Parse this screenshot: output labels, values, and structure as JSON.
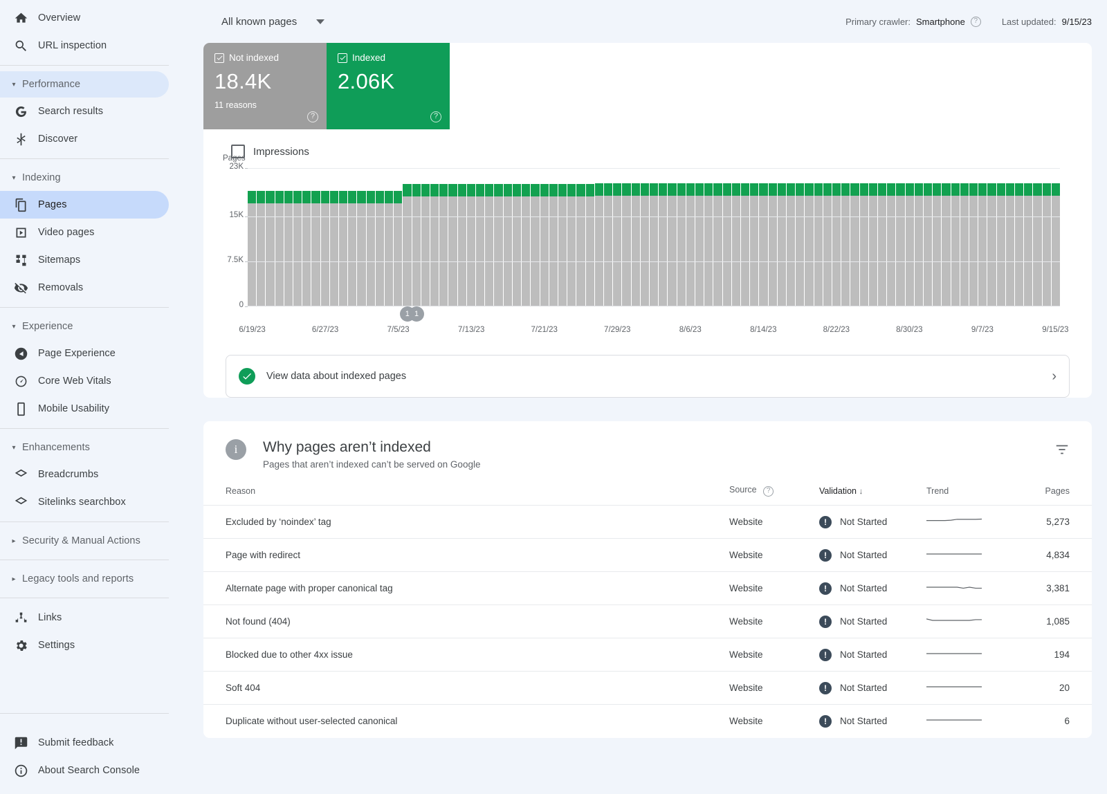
{
  "sidebar": {
    "top_items": [
      {
        "label": "Overview",
        "icon": "home-icon"
      },
      {
        "label": "URL inspection",
        "icon": "search-icon"
      }
    ],
    "groups": [
      {
        "label": "Performance",
        "expanded": true,
        "highlighted": true,
        "items": [
          {
            "label": "Search results",
            "icon": "google-g-icon"
          },
          {
            "label": "Discover",
            "icon": "asterisk-icon"
          }
        ]
      },
      {
        "label": "Indexing",
        "expanded": true,
        "highlighted": false,
        "items": [
          {
            "label": "Pages",
            "icon": "pages-icon",
            "active": true
          },
          {
            "label": "Video pages",
            "icon": "video-icon"
          },
          {
            "label": "Sitemaps",
            "icon": "sitemap-icon"
          },
          {
            "label": "Removals",
            "icon": "eye-off-icon"
          }
        ]
      },
      {
        "label": "Experience",
        "expanded": true,
        "highlighted": false,
        "items": [
          {
            "label": "Page Experience",
            "icon": "page-experience-icon"
          },
          {
            "label": "Core Web Vitals",
            "icon": "gauge-icon"
          },
          {
            "label": "Mobile Usability",
            "icon": "mobile-icon"
          }
        ]
      },
      {
        "label": "Enhancements",
        "expanded": true,
        "highlighted": false,
        "items": [
          {
            "label": "Breadcrumbs",
            "icon": "layers-icon"
          },
          {
            "label": "Sitelinks searchbox",
            "icon": "layers-icon"
          }
        ]
      },
      {
        "label": "Security & Manual Actions",
        "expanded": false,
        "highlighted": false,
        "items": []
      },
      {
        "label": "Legacy tools and reports",
        "expanded": false,
        "highlighted": false,
        "items": []
      }
    ],
    "tail_items": [
      {
        "label": "Links",
        "icon": "links-icon"
      },
      {
        "label": "Settings",
        "icon": "gear-icon"
      }
    ],
    "bottom_items": [
      {
        "label": "Submit feedback",
        "icon": "feedback-icon"
      },
      {
        "label": "About Search Console",
        "icon": "info-icon"
      }
    ]
  },
  "topbar": {
    "page_filter_value": "All known pages",
    "primary_crawler_label": "Primary crawler:",
    "primary_crawler_value": "Smartphone",
    "last_updated_label": "Last updated:",
    "last_updated_value": "9/15/23",
    "help_icon": "help-circle-icon",
    "dropdown_icon": "chevron-down-icon"
  },
  "kpis": [
    {
      "label": "Not indexed",
      "value": "18.4K",
      "sub": "11 reasons",
      "color": "#9e9e9e",
      "checked": true,
      "help_icon": "help-circle-icon"
    },
    {
      "label": "Indexed",
      "value": "2.06K",
      "sub": "",
      "color": "#0f9d58",
      "checked": true,
      "help_icon": "help-circle-icon"
    }
  ],
  "chart_legend": {
    "label": "Impressions",
    "checked": false
  },
  "banner": {
    "text": "View data about indexed pages",
    "status_icon": "check-circle-icon",
    "chevron_icon": "chevron-right-icon"
  },
  "table_card": {
    "title": "Why pages aren’t indexed",
    "subtitle": "Pages that aren’t indexed can’t be served on Google",
    "info_icon": "info-circle-icon",
    "filter_icon": "filter-icon",
    "columns": [
      "Reason",
      "Source",
      "Validation",
      "Trend",
      "Pages"
    ],
    "source_help_icon": "help-circle-icon",
    "sort_column": "Validation",
    "sort_icon": "arrow-down-icon",
    "rows": [
      {
        "reason": "Excluded by ‘noindex’ tag",
        "source": "Website",
        "validation": "Not Started",
        "pages": "5,273",
        "trend": [
          0.52,
          0.52,
          0.52,
          0.52,
          0.55,
          0.62,
          0.62,
          0.62,
          0.62,
          0.64
        ]
      },
      {
        "reason": "Page with redirect",
        "source": "Website",
        "validation": "Not Started",
        "pages": "4,834",
        "trend": [
          0.5,
          0.5,
          0.5,
          0.5,
          0.5,
          0.5,
          0.5,
          0.5,
          0.5,
          0.5
        ]
      },
      {
        "reason": "Alternate page with proper canonical tag",
        "source": "Website",
        "validation": "Not Started",
        "pages": "3,381",
        "trend": [
          0.5,
          0.5,
          0.5,
          0.5,
          0.5,
          0.5,
          0.42,
          0.5,
          0.42,
          0.42
        ]
      },
      {
        "reason": "Not found (404)",
        "source": "Website",
        "validation": "Not Started",
        "pages": "1,085",
        "trend": [
          0.62,
          0.5,
          0.5,
          0.5,
          0.5,
          0.5,
          0.5,
          0.5,
          0.56,
          0.56
        ]
      },
      {
        "reason": "Blocked due to other 4xx issue",
        "source": "Website",
        "validation": "Not Started",
        "pages": "194",
        "trend": [
          0.5,
          0.5,
          0.5,
          0.5,
          0.5,
          0.5,
          0.5,
          0.5,
          0.5,
          0.5
        ]
      },
      {
        "reason": "Soft 404",
        "source": "Website",
        "validation": "Not Started",
        "pages": "20",
        "trend": [
          0.5,
          0.5,
          0.5,
          0.5,
          0.5,
          0.5,
          0.5,
          0.5,
          0.5,
          0.5
        ]
      },
      {
        "reason": "Duplicate without user-selected canonical",
        "source": "Website",
        "validation": "Not Started",
        "pages": "6",
        "trend": [
          0.5,
          0.5,
          0.5,
          0.5,
          0.5,
          0.5,
          0.5,
          0.5,
          0.5,
          0.5
        ]
      }
    ],
    "warning_icon": "exclamation-circle-icon"
  },
  "chart_data": {
    "type": "bar",
    "title": "",
    "subtype": "stacked",
    "xlabel": "",
    "ylabel": "Pages",
    "ylim": [
      0,
      23000
    ],
    "yticks": [
      0,
      7500,
      15000,
      23000
    ],
    "ytick_labels": [
      "0",
      "7.5K",
      "15K",
      "23K"
    ],
    "grid": true,
    "legend_position": "top-left",
    "xtick_labels": [
      "6/19/23",
      "6/27/23",
      "7/5/23",
      "7/13/23",
      "7/21/23",
      "7/29/23",
      "8/6/23",
      "8/14/23",
      "8/22/23",
      "8/30/23",
      "9/7/23",
      "9/15/23"
    ],
    "annotations": [
      {
        "label": "1",
        "x_index": 17
      },
      {
        "label": "1",
        "x_index": 18
      }
    ],
    "x": [
      "6/19/23",
      "6/20/23",
      "6/21/23",
      "6/22/23",
      "6/23/23",
      "6/24/23",
      "6/25/23",
      "6/26/23",
      "6/27/23",
      "6/28/23",
      "6/29/23",
      "6/30/23",
      "7/1/23",
      "7/2/23",
      "7/3/23",
      "7/4/23",
      "7/5/23",
      "7/6/23",
      "7/7/23",
      "7/8/23",
      "7/9/23",
      "7/10/23",
      "7/11/23",
      "7/12/23",
      "7/13/23",
      "7/14/23",
      "7/15/23",
      "7/16/23",
      "7/17/23",
      "7/18/23",
      "7/19/23",
      "7/20/23",
      "7/21/23",
      "7/22/23",
      "7/23/23",
      "7/24/23",
      "7/25/23",
      "7/26/23",
      "7/27/23",
      "7/28/23",
      "7/29/23",
      "7/30/23",
      "7/31/23",
      "8/1/23",
      "8/2/23",
      "8/3/23",
      "8/4/23",
      "8/5/23",
      "8/6/23",
      "8/7/23",
      "8/8/23",
      "8/9/23",
      "8/10/23",
      "8/11/23",
      "8/12/23",
      "8/13/23",
      "8/14/23",
      "8/15/23",
      "8/16/23",
      "8/17/23",
      "8/18/23",
      "8/19/23",
      "8/20/23",
      "8/21/23",
      "8/22/23",
      "8/23/23",
      "8/24/23",
      "8/25/23",
      "8/26/23",
      "8/27/23",
      "8/28/23",
      "8/29/23",
      "8/30/23",
      "8/31/23",
      "9/1/23",
      "9/2/23",
      "9/3/23",
      "9/4/23",
      "9/5/23",
      "9/6/23",
      "9/7/23",
      "9/8/23",
      "9/9/23",
      "9/10/23",
      "9/11/23",
      "9/12/23",
      "9/13/23",
      "9/14/23",
      "9/15/23"
    ],
    "series": [
      {
        "name": "Not indexed",
        "color": "#bdbdbd",
        "values": [
          17100,
          17100,
          17100,
          17100,
          17100,
          17100,
          17100,
          17100,
          17100,
          17100,
          17100,
          17100,
          17100,
          17100,
          17100,
          17100,
          17100,
          18300,
          18300,
          18300,
          18300,
          18300,
          18300,
          18300,
          18300,
          18300,
          18300,
          18300,
          18300,
          18300,
          18300,
          18300,
          18300,
          18300,
          18300,
          18300,
          18300,
          18300,
          18400,
          18400,
          18400,
          18400,
          18400,
          18400,
          18400,
          18400,
          18400,
          18400,
          18400,
          18400,
          18400,
          18400,
          18400,
          18400,
          18400,
          18400,
          18400,
          18400,
          18400,
          18400,
          18400,
          18400,
          18400,
          18400,
          18400,
          18400,
          18400,
          18400,
          18400,
          18400,
          18400,
          18400,
          18400,
          18400,
          18400,
          18400,
          18400,
          18400,
          18400,
          18400,
          18400,
          18400,
          18400,
          18400,
          18400,
          18400,
          18400,
          18400,
          18400,
          18400
        ]
      },
      {
        "name": "Indexed",
        "color": "#12a150",
        "values": [
          2060,
          2060,
          2060,
          2060,
          2060,
          2060,
          2060,
          2060,
          2060,
          2060,
          2060,
          2060,
          2060,
          2060,
          2060,
          2060,
          2060,
          2060,
          2060,
          2060,
          2060,
          2060,
          2060,
          2060,
          2060,
          2060,
          2060,
          2060,
          2060,
          2060,
          2060,
          2060,
          2060,
          2060,
          2060,
          2060,
          2060,
          2060,
          2060,
          2060,
          2060,
          2060,
          2060,
          2060,
          2060,
          2060,
          2060,
          2060,
          2060,
          2060,
          2060,
          2060,
          2060,
          2060,
          2060,
          2060,
          2060,
          2060,
          2060,
          2060,
          2060,
          2060,
          2060,
          2060,
          2060,
          2060,
          2060,
          2060,
          2060,
          2060,
          2060,
          2060,
          2060,
          2060,
          2060,
          2060,
          2060,
          2060,
          2060,
          2060,
          2060,
          2060,
          2060,
          2060,
          2060,
          2060,
          2060,
          2060,
          2060,
          2060
        ]
      }
    ]
  }
}
